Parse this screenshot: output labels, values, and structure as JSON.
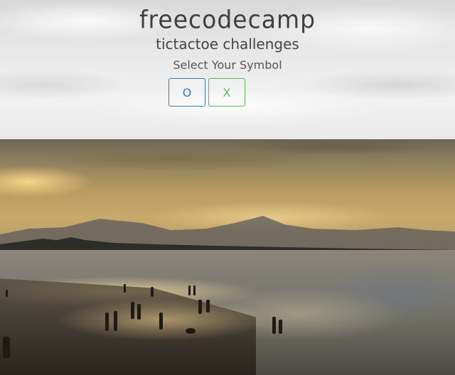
{
  "header": {
    "brand": "freecodecamp",
    "subtitle": "tictactoe challenges",
    "prompt": "Select Your Symbol"
  },
  "symbols": [
    {
      "label": "O",
      "color": "#337ab7"
    },
    {
      "label": "X",
      "color": "#5cb85c"
    }
  ]
}
